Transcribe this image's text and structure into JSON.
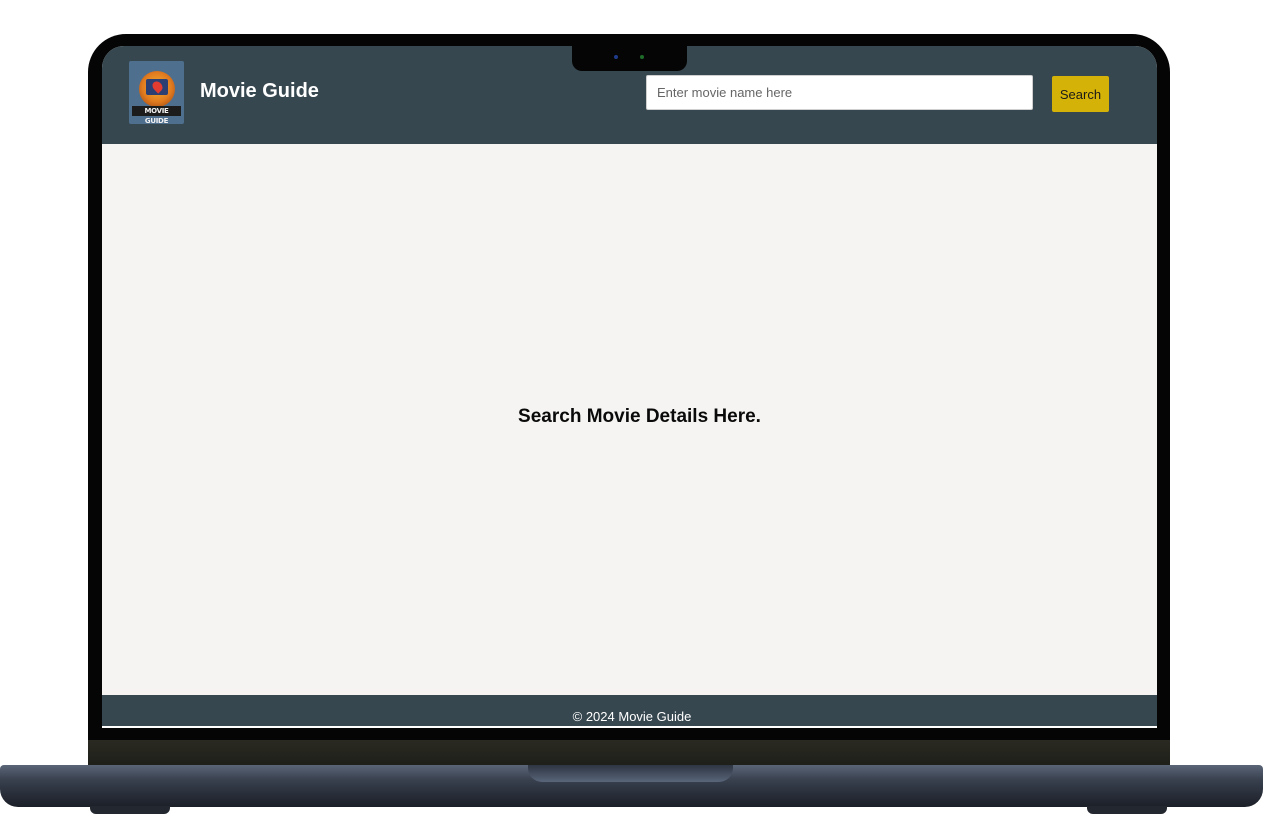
{
  "header": {
    "logo_text": "MOVIE GUIDE",
    "title": "Movie Guide",
    "search": {
      "placeholder": "Enter movie name here",
      "value": "",
      "button_label": "Search"
    }
  },
  "main": {
    "message": "Search Movie Details Here."
  },
  "footer": {
    "text": "© 2024 Movie Guide"
  },
  "colors": {
    "header_bg": "#37474f",
    "button_bg": "#d4b207",
    "page_bg": "#f5f4f2"
  }
}
